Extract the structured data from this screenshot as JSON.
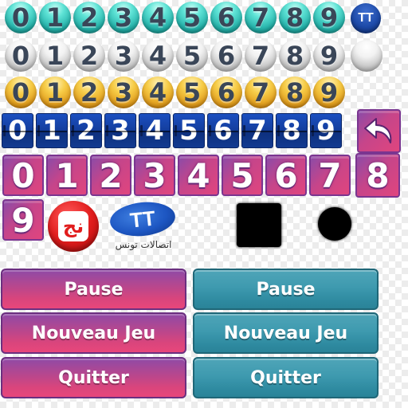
{
  "digit_rows": {
    "teal_balls": [
      "0",
      "1",
      "2",
      "3",
      "4",
      "5",
      "6",
      "7",
      "8",
      "9"
    ],
    "teal_logo": "TT",
    "silver_balls": [
      "0",
      "1",
      "2",
      "3",
      "4",
      "5",
      "6",
      "7",
      "8",
      "9"
    ],
    "gold_balls": [
      "0",
      "1",
      "2",
      "3",
      "4",
      "5",
      "6",
      "7",
      "8",
      "9"
    ],
    "blue_tiles": [
      "0",
      "1",
      "2",
      "3",
      "4",
      "5",
      "6",
      "7",
      "8",
      "9"
    ],
    "pink_tiles": [
      "0",
      "1",
      "2",
      "3",
      "4",
      "5",
      "6",
      "7",
      "8",
      "9"
    ]
  },
  "logos": {
    "nj_text": "نج",
    "tt_text": "TT",
    "tt_arabic": "اتصالات تونس"
  },
  "icons": {
    "undo": "undo-arrow-icon",
    "square": "square-icon",
    "circle": "circle-icon"
  },
  "buttons": {
    "pink": {
      "pause": "Pause",
      "new_game": "Nouveau Jeu",
      "quit": "Quitter"
    },
    "teal": {
      "pause": "Pause",
      "new_game": "Nouveau Jeu",
      "quit": "Quitter"
    }
  },
  "colors": {
    "teal": "#23b0a8",
    "gold": "#f0b12a",
    "blue_tile": "#143e9e",
    "pink": "#d9457c",
    "purple": "#8f4aa6",
    "button_teal": "#3e9aaf"
  }
}
